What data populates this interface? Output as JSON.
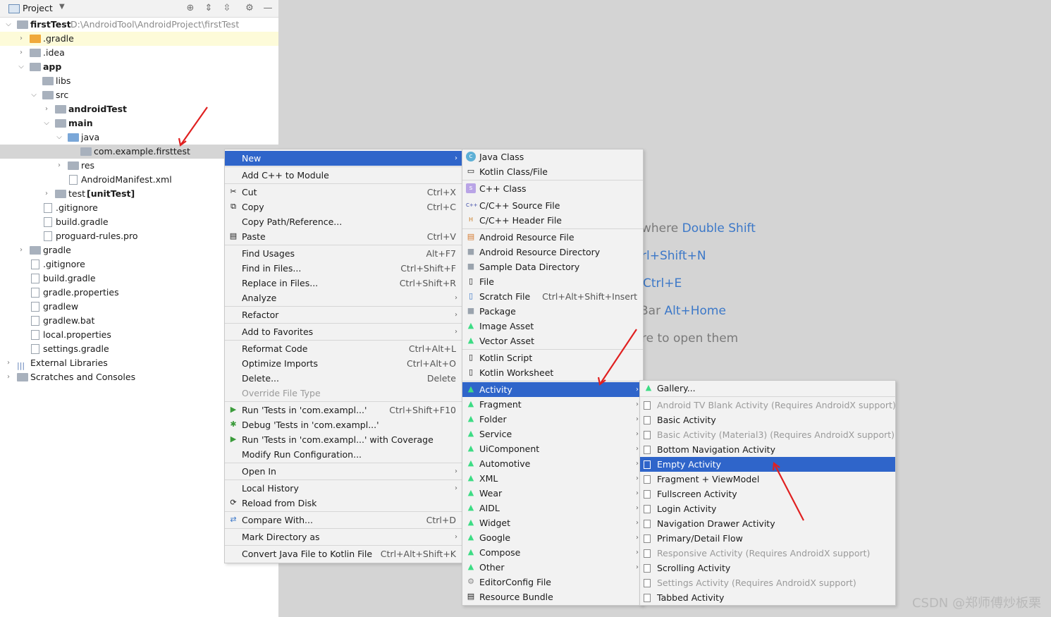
{
  "panel": {
    "title": "Project",
    "tree": [
      {
        "label": "firstTest",
        "extra": "D:\\AndroidTool\\AndroidProject\\firstTest",
        "bold": true
      },
      {
        "label": ".gradle"
      },
      {
        "label": ".idea"
      },
      {
        "label": "app",
        "bold": true
      },
      {
        "label": "libs"
      },
      {
        "label": "src"
      },
      {
        "label": "androidTest",
        "bold": true
      },
      {
        "label": "main",
        "bold": true
      },
      {
        "label": "java"
      },
      {
        "label": "com.example.firsttest"
      },
      {
        "label": "res"
      },
      {
        "label": "AndroidManifest.xml"
      },
      {
        "label": "test",
        "extra": "[unitTest]"
      },
      {
        "label": ".gitignore"
      },
      {
        "label": "build.gradle"
      },
      {
        "label": "proguard-rules.pro"
      },
      {
        "label": "gradle"
      },
      {
        "label": ".gitignore"
      },
      {
        "label": "build.gradle"
      },
      {
        "label": "gradle.properties"
      },
      {
        "label": "gradlew"
      },
      {
        "label": "gradlew.bat"
      },
      {
        "label": "local.properties"
      },
      {
        "label": "settings.gradle"
      },
      {
        "label": "External Libraries"
      },
      {
        "label": "Scratches and Consoles"
      }
    ]
  },
  "context_menu": {
    "items": [
      {
        "label": "New"
      },
      {
        "label": "Add C++ to Module"
      },
      {
        "label": "Cut",
        "shortcut": "Ctrl+X"
      },
      {
        "label": "Copy",
        "shortcut": "Ctrl+C"
      },
      {
        "label": "Copy Path/Reference..."
      },
      {
        "label": "Paste",
        "shortcut": "Ctrl+V"
      },
      {
        "label": "Find Usages",
        "shortcut": "Alt+F7"
      },
      {
        "label": "Find in Files...",
        "shortcut": "Ctrl+Shift+F"
      },
      {
        "label": "Replace in Files...",
        "shortcut": "Ctrl+Shift+R"
      },
      {
        "label": "Analyze"
      },
      {
        "label": "Refactor"
      },
      {
        "label": "Add to Favorites"
      },
      {
        "label": "Reformat Code",
        "shortcut": "Ctrl+Alt+L"
      },
      {
        "label": "Optimize Imports",
        "shortcut": "Ctrl+Alt+O"
      },
      {
        "label": "Delete...",
        "shortcut": "Delete"
      },
      {
        "label": "Override File Type"
      },
      {
        "label": "Run 'Tests in 'com.exampl...'",
        "shortcut": "Ctrl+Shift+F10"
      },
      {
        "label": "Debug 'Tests in 'com.exampl...'"
      },
      {
        "label": "Run 'Tests in 'com.exampl...' with Coverage"
      },
      {
        "label": "Modify Run Configuration..."
      },
      {
        "label": "Open In"
      },
      {
        "label": "Local History"
      },
      {
        "label": "Reload from Disk"
      },
      {
        "label": "Compare With...",
        "shortcut": "Ctrl+D"
      },
      {
        "label": "Mark Directory as"
      },
      {
        "label": "Convert Java File to Kotlin File",
        "shortcut": "Ctrl+Alt+Shift+K"
      }
    ]
  },
  "new_menu": {
    "items": [
      {
        "label": "Java Class"
      },
      {
        "label": "Kotlin Class/File"
      },
      {
        "label": "C++ Class"
      },
      {
        "label": "C/C++ Source File"
      },
      {
        "label": "C/C++ Header File"
      },
      {
        "label": "Android Resource File"
      },
      {
        "label": "Android Resource Directory"
      },
      {
        "label": "Sample Data Directory"
      },
      {
        "label": "File"
      },
      {
        "label": "Scratch File",
        "shortcut": "Ctrl+Alt+Shift+Insert"
      },
      {
        "label": "Package"
      },
      {
        "label": "Image Asset"
      },
      {
        "label": "Vector Asset"
      },
      {
        "label": "Kotlin Script"
      },
      {
        "label": "Kotlin Worksheet"
      },
      {
        "label": "Activity"
      },
      {
        "label": "Fragment"
      },
      {
        "label": "Folder"
      },
      {
        "label": "Service"
      },
      {
        "label": "UiComponent"
      },
      {
        "label": "Automotive"
      },
      {
        "label": "XML"
      },
      {
        "label": "Wear"
      },
      {
        "label": "AIDL"
      },
      {
        "label": "Widget"
      },
      {
        "label": "Google"
      },
      {
        "label": "Compose"
      },
      {
        "label": "Other"
      },
      {
        "label": "EditorConfig File"
      },
      {
        "label": "Resource Bundle"
      }
    ]
  },
  "activity_menu": {
    "items": [
      {
        "label": "Gallery..."
      },
      {
        "label": "Android TV Blank Activity (Requires AndroidX support)"
      },
      {
        "label": "Basic Activity"
      },
      {
        "label": "Basic Activity (Material3) (Requires AndroidX support)"
      },
      {
        "label": "Bottom Navigation Activity"
      },
      {
        "label": "Empty Activity"
      },
      {
        "label": "Fragment + ViewModel"
      },
      {
        "label": "Fullscreen Activity"
      },
      {
        "label": "Login Activity"
      },
      {
        "label": "Navigation Drawer Activity"
      },
      {
        "label": "Primary/Detail Flow"
      },
      {
        "label": "Responsive Activity (Requires AndroidX support)"
      },
      {
        "label": "Scrolling Activity"
      },
      {
        "label": "Settings Activity (Requires AndroidX support)"
      },
      {
        "label": "Tabbed Activity"
      }
    ]
  },
  "hints": [
    {
      "text": "where ",
      "key": "Double Shift"
    },
    {
      "text": "",
      "key": "rl+Shift+N"
    },
    {
      "text": "",
      "key": "Ctrl+E"
    },
    {
      "text": "Bar ",
      "key": "Alt+Home"
    },
    {
      "text": "re to open them",
      "key": ""
    }
  ],
  "watermark": "CSDN @郑师傅炒板栗",
  "colors": {
    "selection": "#2f65ca",
    "android": "#3ddc84",
    "annotation_arrow": "#e02020"
  }
}
